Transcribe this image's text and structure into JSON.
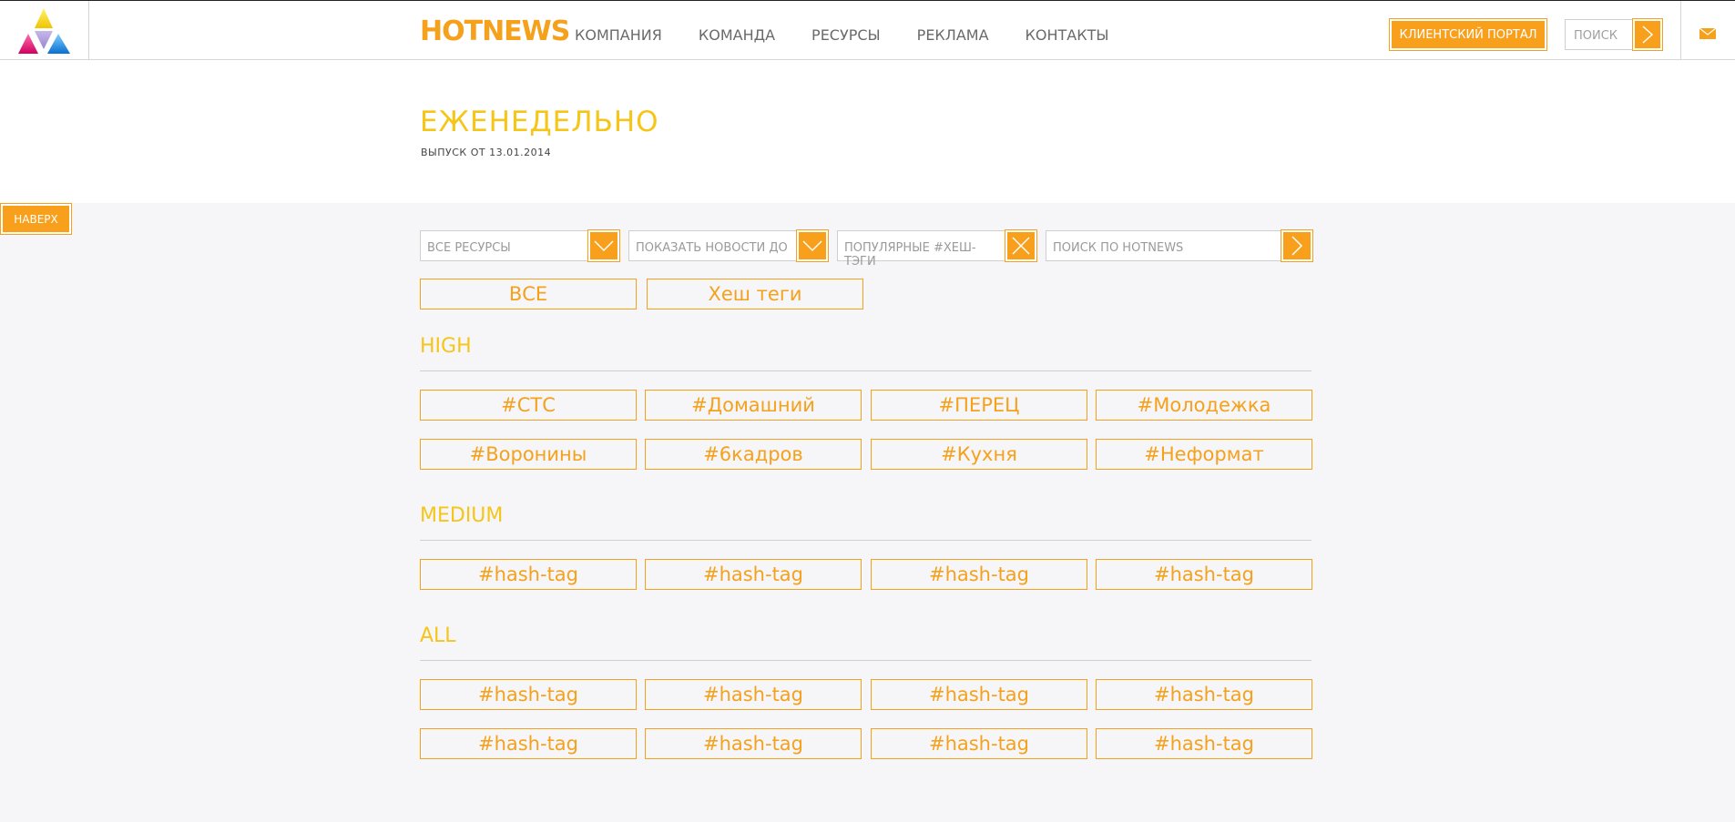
{
  "header": {
    "brand": "HOTNEWS",
    "nav": [
      "КОМПАНИЯ",
      "КОМАНДА",
      "РЕСУРСЫ",
      "РЕКЛАМА",
      "КОНТАКТЫ"
    ],
    "portal_label": "КЛИЕНТСКИЙ ПОРТАЛ",
    "search_placeholder": "ПОИСК"
  },
  "page": {
    "title": "ЕЖЕНЕДЕЛЬНО",
    "issue": "ВЫПУСК ОТ 13.01.2014",
    "up_label": "НАВЕРХ"
  },
  "filters": {
    "resources": "ВСЕ РЕСУРСЫ",
    "show_until": "ПОКАЗАТЬ НОВОСТИ ДО",
    "popular_tags": "ПОПУЛЯРНЫЕ #ХЕШ-ТЭГИ",
    "search": "ПОИСК ПО HOTNEWS"
  },
  "tabs": [
    "ВСЕ",
    "Хеш теги"
  ],
  "sections": {
    "high": {
      "label": "HIGH",
      "tags": [
        "#СТС",
        "#Домашний",
        "#ПЕРЕЦ",
        "#Молодежка",
        "#Воронины",
        "#6кадров",
        "#Кухня",
        "#Неформат"
      ]
    },
    "medium": {
      "label": "MEDIUM",
      "tags": [
        "#hash-tag",
        "#hash-tag",
        "#hash-tag",
        "#hash-tag"
      ]
    },
    "all": {
      "label": "ALL",
      "tags": [
        "#hash-tag",
        "#hash-tag",
        "#hash-tag",
        "#hash-tag",
        "#hash-tag",
        "#hash-tag",
        "#hash-tag",
        "#hash-tag"
      ]
    }
  },
  "colors": {
    "accent": "#f8a01b",
    "tag_text": "#f5a11c",
    "title": "#f5c518",
    "background": "#f6f6f8"
  }
}
